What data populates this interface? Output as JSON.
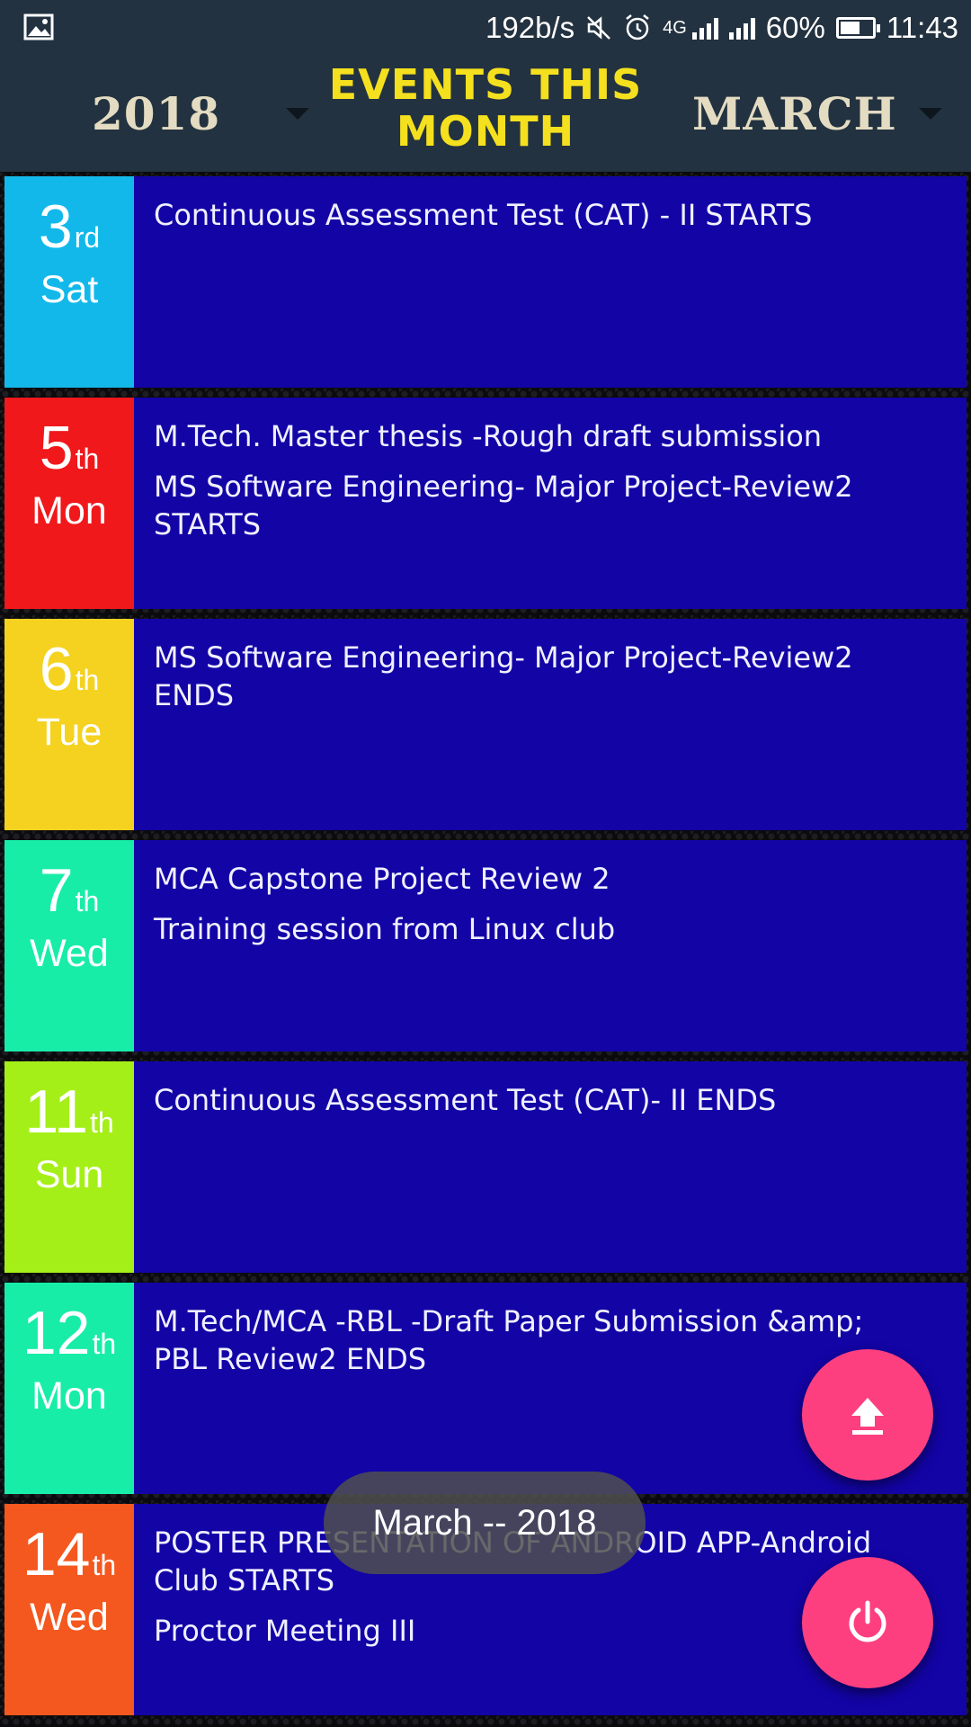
{
  "status_bar": {
    "speed": "192b/s",
    "network": "4G",
    "battery": "60%",
    "battery_level": 0.6,
    "time": "11:43",
    "icons": [
      "image-icon",
      "mute-icon",
      "alarm-icon",
      "signal-icon",
      "signal-icon",
      "battery-icon"
    ]
  },
  "header": {
    "year": "2018",
    "title": "EVENTS THIS MONTH",
    "month": "MARCH"
  },
  "events": [
    {
      "num": "3",
      "suffix": "rd",
      "day": "Sat",
      "color": "#13b8ea",
      "items": [
        "Continuous Assessment Test (CAT) - II  STARTS"
      ]
    },
    {
      "num": "5",
      "suffix": "th",
      "day": "Mon",
      "color": "#f0181b",
      "items": [
        "M.Tech. Master thesis -Rough draft submission",
        "MS Software Engineering- Major Project-Review2 STARTS"
      ]
    },
    {
      "num": "6",
      "suffix": "th",
      "day": "Tue",
      "color": "#f4d21f",
      "items": [
        "MS Software Engineering- Major Project-Review2 ENDS"
      ]
    },
    {
      "num": "7",
      "suffix": "th",
      "day": "Wed",
      "color": "#18eda8",
      "items": [
        "MCA Capstone Project Review 2",
        "Training session from Linux club"
      ]
    },
    {
      "num": "11",
      "suffix": "th",
      "day": "Sun",
      "color": "#a5ef18",
      "items": [
        "Continuous Assessment Test (CAT)- II  ENDS"
      ]
    },
    {
      "num": "12",
      "suffix": "th",
      "day": "Mon",
      "color": "#18eda8",
      "items": [
        "M.Tech/MCA -RBL -Draft Paper Submission &amp; PBL Review2 ENDS"
      ]
    },
    {
      "num": "14",
      "suffix": "th",
      "day": "Wed",
      "color": "#f4581f",
      "items": [
        "POSTER PRESENTATION OF ANDROID APP-Android Club STARTS",
        "Proctor Meeting III"
      ]
    }
  ],
  "toast": "March -- 2018",
  "fabs": {
    "upload_icon": "upload-icon",
    "power_icon": "power-icon",
    "color": "#fd3f80"
  }
}
